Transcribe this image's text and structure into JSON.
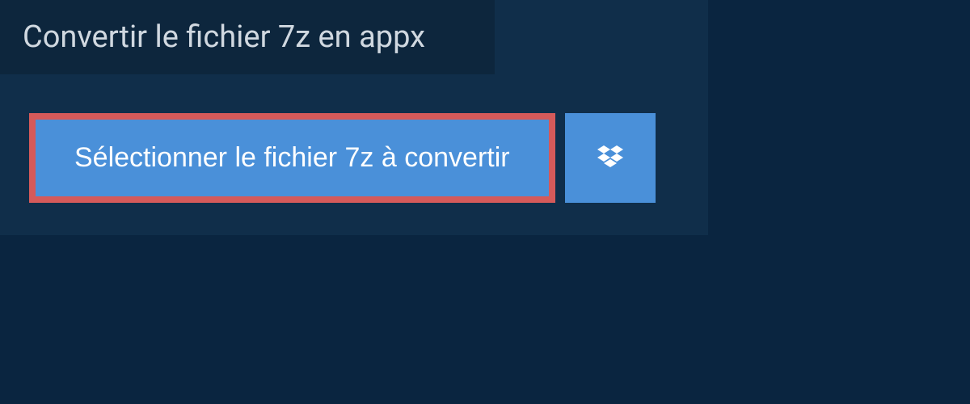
{
  "header": {
    "title": "Convertir le fichier 7z en appx"
  },
  "actions": {
    "select_file_label": "Sélectionner le fichier 7z à convertir"
  }
}
